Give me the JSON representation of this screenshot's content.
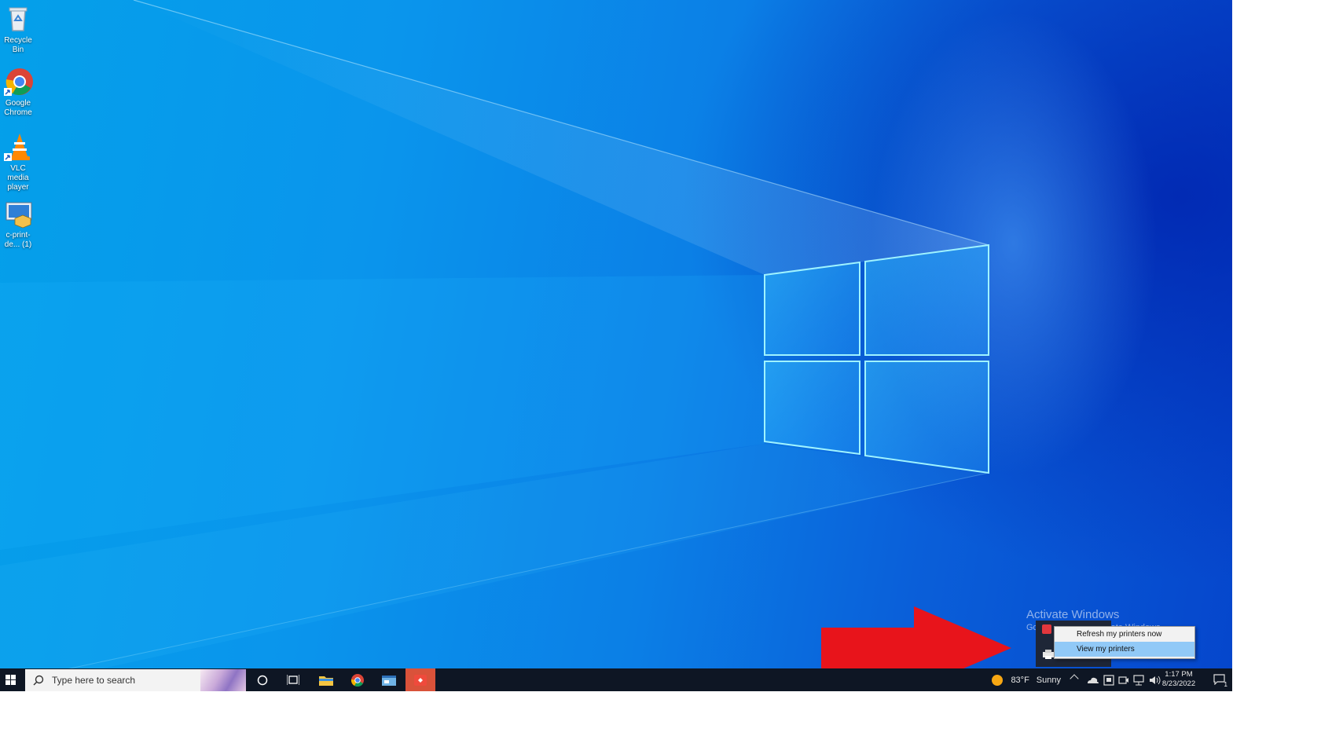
{
  "desktop": {
    "icons": [
      {
        "label": "Recycle Bin",
        "icon": "recycle-bin-icon"
      },
      {
        "label": "Google Chrome",
        "icon": "chrome-icon"
      },
      {
        "label": "VLC media player",
        "icon": "vlc-icon"
      },
      {
        "label": "c-print-de... (1)",
        "icon": "installer-icon"
      }
    ],
    "watermark": {
      "title": "Activate Windows",
      "subtitle": "Go to Settings to activate Windows."
    }
  },
  "context_menu": {
    "items": [
      {
        "label": "Refresh my printers now",
        "selected": false
      },
      {
        "label": "View my printers",
        "selected": true
      }
    ]
  },
  "taskbar": {
    "search_placeholder": "Type here to search",
    "weather": {
      "temp": "83°F",
      "condition": "Sunny"
    },
    "clock": {
      "time": "1:17 PM",
      "date": "8/23/2022"
    },
    "notification_count": "1"
  },
  "colors": {
    "taskbar_bg": "#0e1624",
    "menu_highlight": "#91c9f7",
    "annotation_arrow": "#e8141b"
  }
}
